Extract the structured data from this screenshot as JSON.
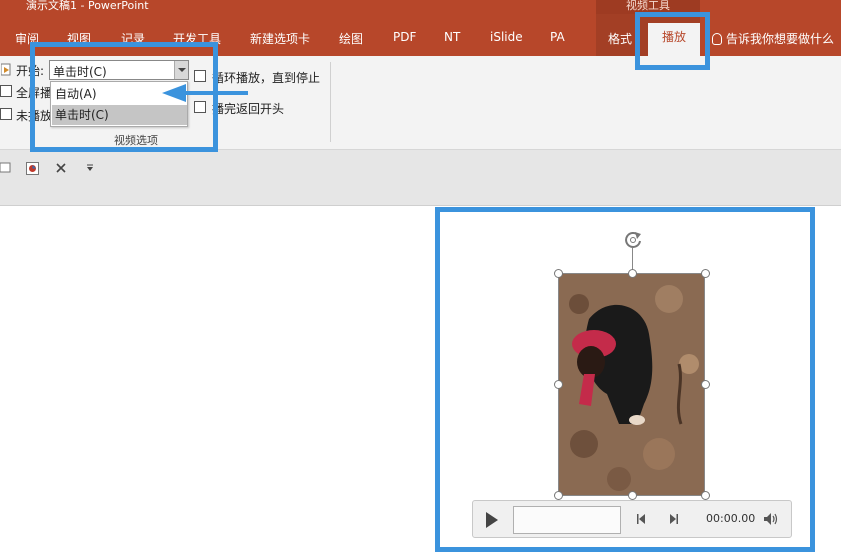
{
  "window": {
    "title": "演示文稿1  -  PowerPoint",
    "context_group": "视频工具"
  },
  "ribbon_tabs": [
    {
      "label": "审阅"
    },
    {
      "label": "视图"
    },
    {
      "label": "记录"
    },
    {
      "label": "开发工具"
    },
    {
      "label": "新建选项卡"
    },
    {
      "label": "绘图"
    },
    {
      "label": "PDF"
    },
    {
      "label": "NT"
    },
    {
      "label": "iSlide"
    },
    {
      "label": "PA"
    },
    {
      "label": "格式"
    },
    {
      "label": "播放",
      "active": true
    }
  ],
  "tell_me": "告诉我你想要做什么",
  "video_options": {
    "start_label": "开始:",
    "start_value": "单击时(C)",
    "dropdown_options": [
      "自动(A)",
      "单击时(C)"
    ],
    "fullscreen_label": "全屏播",
    "hide_label": "未播放",
    "loop_label": "循环播放，直到停止",
    "rewind_label": "播完返回开头",
    "group_label": "视频选项"
  },
  "player": {
    "time": "00:00.00"
  },
  "colors": {
    "brand": "#b7472a",
    "annotation": "#3b93dd"
  },
  "icons": [
    "play-icon",
    "rotate-icon",
    "speaker-icon",
    "step-back-icon",
    "step-forward-icon",
    "close-icon",
    "dropdown-arrow-icon"
  ]
}
